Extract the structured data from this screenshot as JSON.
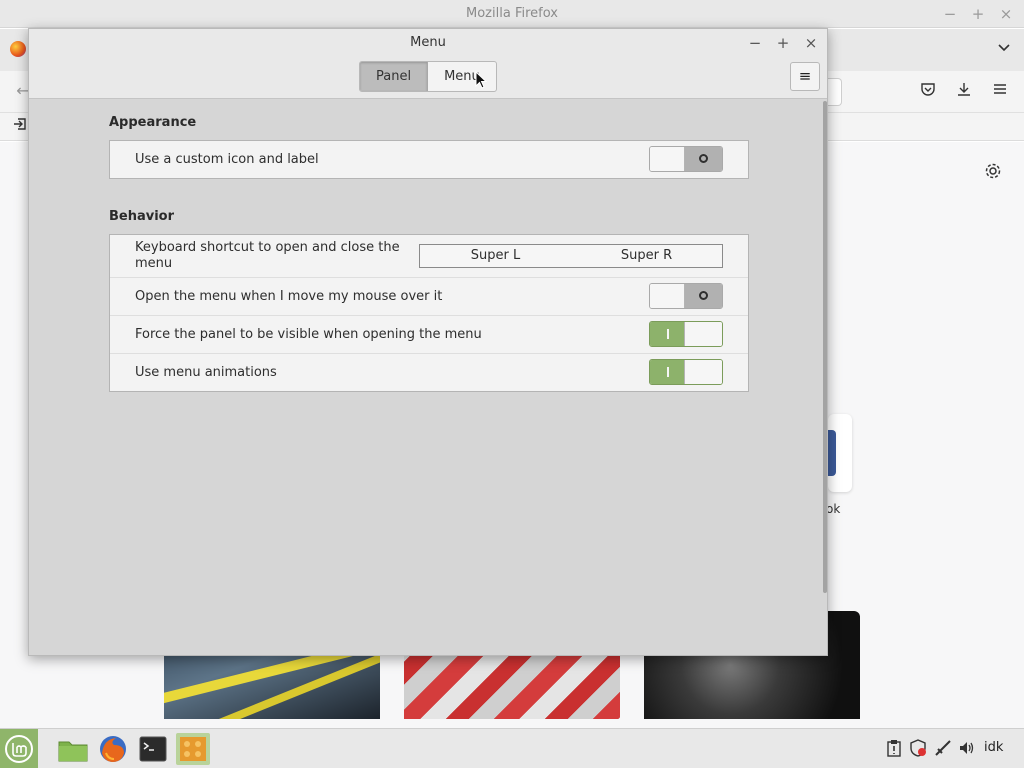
{
  "firefox": {
    "window_title": "Mozilla Firefox",
    "minimize": "−",
    "maximize": "+",
    "close": "×",
    "shortcut_label_partial": "ok"
  },
  "dialog": {
    "title": "Menu",
    "minimize": "−",
    "maximize": "+",
    "close": "×",
    "tabs": [
      {
        "label": "Panel",
        "active": true
      },
      {
        "label": "Menu",
        "active": false
      }
    ],
    "hamburger": "≡",
    "appearance": {
      "title": "Appearance",
      "rows": [
        {
          "label": "Use a custom icon and label",
          "enabled": false
        }
      ]
    },
    "behavior": {
      "title": "Behavior",
      "keyboard_shortcut": {
        "label": "Keyboard shortcut to open and close the menu",
        "keys": [
          "Super L",
          "Super R"
        ]
      },
      "rows": [
        {
          "label": "Open the menu when I move my mouse over it",
          "enabled": false
        },
        {
          "label": "Force the panel to be visible when opening the menu",
          "enabled": true
        },
        {
          "label": "Use menu animations",
          "enabled": true
        }
      ]
    }
  },
  "taskbar": {
    "user": "idk",
    "accent_color": "#8fb56a"
  }
}
